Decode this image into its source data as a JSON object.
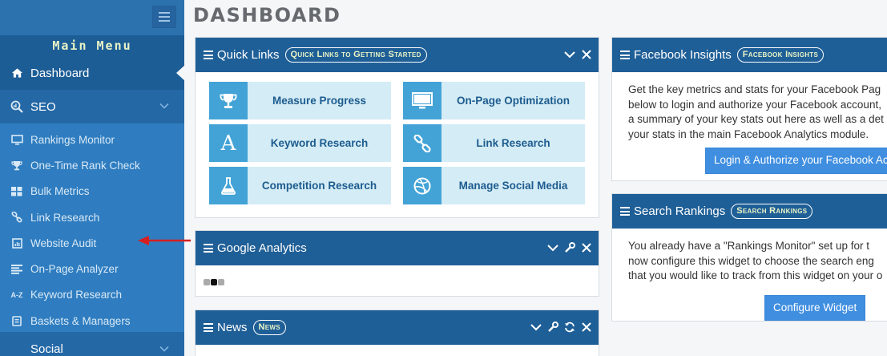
{
  "page": {
    "title": "DASHBOARD"
  },
  "sidebar": {
    "menu_title": "Main Menu",
    "dashboard": {
      "label": "Dashboard",
      "icon": "home-icon"
    },
    "seo": {
      "label": "SEO",
      "icon": "search-chart-icon"
    },
    "items": [
      {
        "label": "Rankings Monitor",
        "icon": "monitor-icon"
      },
      {
        "label": "One-Time Rank Check",
        "icon": "trophy-icon"
      },
      {
        "label": "Bulk Metrics",
        "icon": "grid-icon"
      },
      {
        "label": "Link Research",
        "icon": "link-icon"
      },
      {
        "label": "Website Audit",
        "icon": "audit-icon"
      },
      {
        "label": "On-Page Analyzer",
        "icon": "list-icon"
      },
      {
        "label": "Keyword Research",
        "icon": "a-z-icon",
        "icon_text": "A-Z"
      },
      {
        "label": "Baskets & Managers",
        "icon": "basket-icon"
      }
    ],
    "social": {
      "label": "Social"
    }
  },
  "panels": {
    "quick_links": {
      "title": "Quick Links",
      "badge": "Quick Links to Getting Started",
      "tiles": [
        {
          "label": "Measure Progress",
          "icon": "trophy-icon"
        },
        {
          "label": "On-Page Optimization",
          "icon": "monitor-icon"
        },
        {
          "label": "Keyword Research",
          "icon": "letter-a-icon",
          "icon_text": "A"
        },
        {
          "label": "Link Research",
          "icon": "link-icon"
        },
        {
          "label": "Competition Research",
          "icon": "flask-icon"
        },
        {
          "label": "Manage Social Media",
          "icon": "dribbble-icon"
        }
      ]
    },
    "google_analytics": {
      "title": "Google Analytics"
    },
    "news": {
      "title": "News",
      "badge": "News"
    },
    "facebook": {
      "title": "Facebook Insights",
      "badge": "Facebook Insights",
      "lines": [
        "Get the key metrics and stats for your Facebook Pag",
        "below to login and authorize your Facebook account,",
        "a summary of your key stats out here as well as a det",
        "your stats in the main Facebook Analytics module."
      ],
      "button": "Login & Authorize your Facebook Ac"
    },
    "search_rankings": {
      "title": "Search Rankings",
      "badge": "Search Rankings",
      "lines": [
        "You already have a \"Rankings Monitor\" set up for t",
        "now configure this widget to choose the search eng",
        "that you would like to track from this widget on your o"
      ],
      "button": "Configure Widget"
    }
  }
}
